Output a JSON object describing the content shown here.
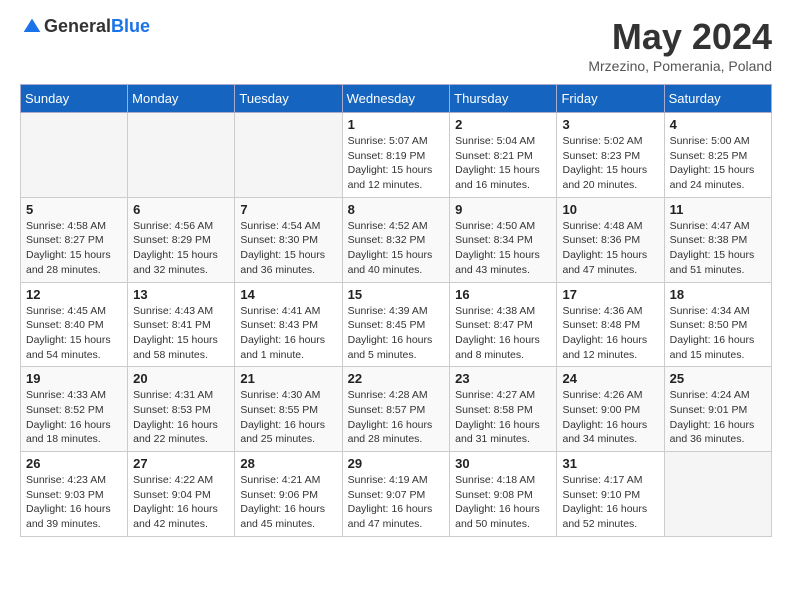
{
  "header": {
    "logo_general": "General",
    "logo_blue": "Blue",
    "month_title": "May 2024",
    "location": "Mrzezino, Pomerania, Poland"
  },
  "days_of_week": [
    "Sunday",
    "Monday",
    "Tuesday",
    "Wednesday",
    "Thursday",
    "Friday",
    "Saturday"
  ],
  "weeks": [
    [
      {
        "num": "",
        "sunrise": "",
        "sunset": "",
        "daylight": ""
      },
      {
        "num": "",
        "sunrise": "",
        "sunset": "",
        "daylight": ""
      },
      {
        "num": "",
        "sunrise": "",
        "sunset": "",
        "daylight": ""
      },
      {
        "num": "1",
        "sunrise": "5:07 AM",
        "sunset": "8:19 PM",
        "daylight": "15 hours and 12 minutes."
      },
      {
        "num": "2",
        "sunrise": "5:04 AM",
        "sunset": "8:21 PM",
        "daylight": "15 hours and 16 minutes."
      },
      {
        "num": "3",
        "sunrise": "5:02 AM",
        "sunset": "8:23 PM",
        "daylight": "15 hours and 20 minutes."
      },
      {
        "num": "4",
        "sunrise": "5:00 AM",
        "sunset": "8:25 PM",
        "daylight": "15 hours and 24 minutes."
      }
    ],
    [
      {
        "num": "5",
        "sunrise": "4:58 AM",
        "sunset": "8:27 PM",
        "daylight": "15 hours and 28 minutes."
      },
      {
        "num": "6",
        "sunrise": "4:56 AM",
        "sunset": "8:29 PM",
        "daylight": "15 hours and 32 minutes."
      },
      {
        "num": "7",
        "sunrise": "4:54 AM",
        "sunset": "8:30 PM",
        "daylight": "15 hours and 36 minutes."
      },
      {
        "num": "8",
        "sunrise": "4:52 AM",
        "sunset": "8:32 PM",
        "daylight": "15 hours and 40 minutes."
      },
      {
        "num": "9",
        "sunrise": "4:50 AM",
        "sunset": "8:34 PM",
        "daylight": "15 hours and 43 minutes."
      },
      {
        "num": "10",
        "sunrise": "4:48 AM",
        "sunset": "8:36 PM",
        "daylight": "15 hours and 47 minutes."
      },
      {
        "num": "11",
        "sunrise": "4:47 AM",
        "sunset": "8:38 PM",
        "daylight": "15 hours and 51 minutes."
      }
    ],
    [
      {
        "num": "12",
        "sunrise": "4:45 AM",
        "sunset": "8:40 PM",
        "daylight": "15 hours and 54 minutes."
      },
      {
        "num": "13",
        "sunrise": "4:43 AM",
        "sunset": "8:41 PM",
        "daylight": "15 hours and 58 minutes."
      },
      {
        "num": "14",
        "sunrise": "4:41 AM",
        "sunset": "8:43 PM",
        "daylight": "16 hours and 1 minute."
      },
      {
        "num": "15",
        "sunrise": "4:39 AM",
        "sunset": "8:45 PM",
        "daylight": "16 hours and 5 minutes."
      },
      {
        "num": "16",
        "sunrise": "4:38 AM",
        "sunset": "8:47 PM",
        "daylight": "16 hours and 8 minutes."
      },
      {
        "num": "17",
        "sunrise": "4:36 AM",
        "sunset": "8:48 PM",
        "daylight": "16 hours and 12 minutes."
      },
      {
        "num": "18",
        "sunrise": "4:34 AM",
        "sunset": "8:50 PM",
        "daylight": "16 hours and 15 minutes."
      }
    ],
    [
      {
        "num": "19",
        "sunrise": "4:33 AM",
        "sunset": "8:52 PM",
        "daylight": "16 hours and 18 minutes."
      },
      {
        "num": "20",
        "sunrise": "4:31 AM",
        "sunset": "8:53 PM",
        "daylight": "16 hours and 22 minutes."
      },
      {
        "num": "21",
        "sunrise": "4:30 AM",
        "sunset": "8:55 PM",
        "daylight": "16 hours and 25 minutes."
      },
      {
        "num": "22",
        "sunrise": "4:28 AM",
        "sunset": "8:57 PM",
        "daylight": "16 hours and 28 minutes."
      },
      {
        "num": "23",
        "sunrise": "4:27 AM",
        "sunset": "8:58 PM",
        "daylight": "16 hours and 31 minutes."
      },
      {
        "num": "24",
        "sunrise": "4:26 AM",
        "sunset": "9:00 PM",
        "daylight": "16 hours and 34 minutes."
      },
      {
        "num": "25",
        "sunrise": "4:24 AM",
        "sunset": "9:01 PM",
        "daylight": "16 hours and 36 minutes."
      }
    ],
    [
      {
        "num": "26",
        "sunrise": "4:23 AM",
        "sunset": "9:03 PM",
        "daylight": "16 hours and 39 minutes."
      },
      {
        "num": "27",
        "sunrise": "4:22 AM",
        "sunset": "9:04 PM",
        "daylight": "16 hours and 42 minutes."
      },
      {
        "num": "28",
        "sunrise": "4:21 AM",
        "sunset": "9:06 PM",
        "daylight": "16 hours and 45 minutes."
      },
      {
        "num": "29",
        "sunrise": "4:19 AM",
        "sunset": "9:07 PM",
        "daylight": "16 hours and 47 minutes."
      },
      {
        "num": "30",
        "sunrise": "4:18 AM",
        "sunset": "9:08 PM",
        "daylight": "16 hours and 50 minutes."
      },
      {
        "num": "31",
        "sunrise": "4:17 AM",
        "sunset": "9:10 PM",
        "daylight": "16 hours and 52 minutes."
      },
      {
        "num": "",
        "sunrise": "",
        "sunset": "",
        "daylight": ""
      }
    ]
  ],
  "labels": {
    "sunrise_prefix": "Sunrise: ",
    "sunset_prefix": "Sunset: ",
    "daylight_prefix": "Daylight: "
  }
}
